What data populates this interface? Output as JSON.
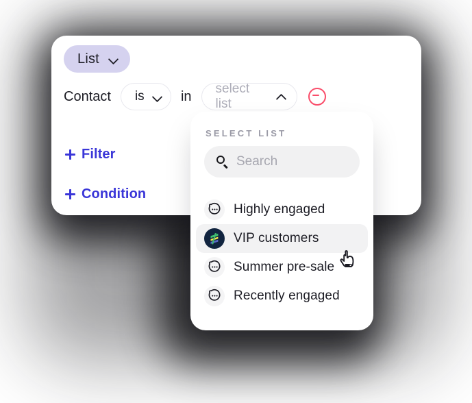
{
  "card": {
    "type_pill": {
      "label": "List",
      "icon": "chevron-down-icon"
    },
    "condition": {
      "subject": "Contact",
      "operator": "is",
      "operator_icon": "chevron-down-icon",
      "joiner": "in",
      "value_placeholder": "select list",
      "value_icon": "chevron-up-icon",
      "remove_icon": "circle-minus-icon"
    },
    "add_filter": {
      "label": "Filter",
      "icon": "plus-icon"
    },
    "add_condition": {
      "label": "Condition",
      "icon": "plus-icon"
    }
  },
  "dropdown": {
    "title": "SELECT LIST",
    "search": {
      "placeholder": "Search",
      "value": "",
      "icon": "search-icon"
    },
    "options": [
      {
        "label": "Highly engaged",
        "icon": "chat-bubble-icon",
        "selected": false
      },
      {
        "label": "VIP customers",
        "icon": "brand-logo-icon",
        "selected": true
      },
      {
        "label": "Summer pre-sale",
        "icon": "chat-bubble-icon",
        "selected": false
      },
      {
        "label": "Recently engaged",
        "icon": "chat-bubble-icon",
        "selected": false
      }
    ]
  },
  "cursor": {
    "icon": "pointing-hand-cursor"
  },
  "colors": {
    "pill_bg": "#d5d2ef",
    "accent_link": "#3a36d8",
    "remove_red": "#fa4d6a",
    "text_primary": "#1c1c24",
    "text_muted": "#a7a7b0",
    "panel_title": "#9a9aa6",
    "row_highlight": "#f2f2f3",
    "search_bg": "#f1f1f2",
    "logo_navy": "#11243f",
    "logo_green": "#3fbf71",
    "logo_yellow": "#f2e14c",
    "logo_blue": "#5b68c9"
  }
}
